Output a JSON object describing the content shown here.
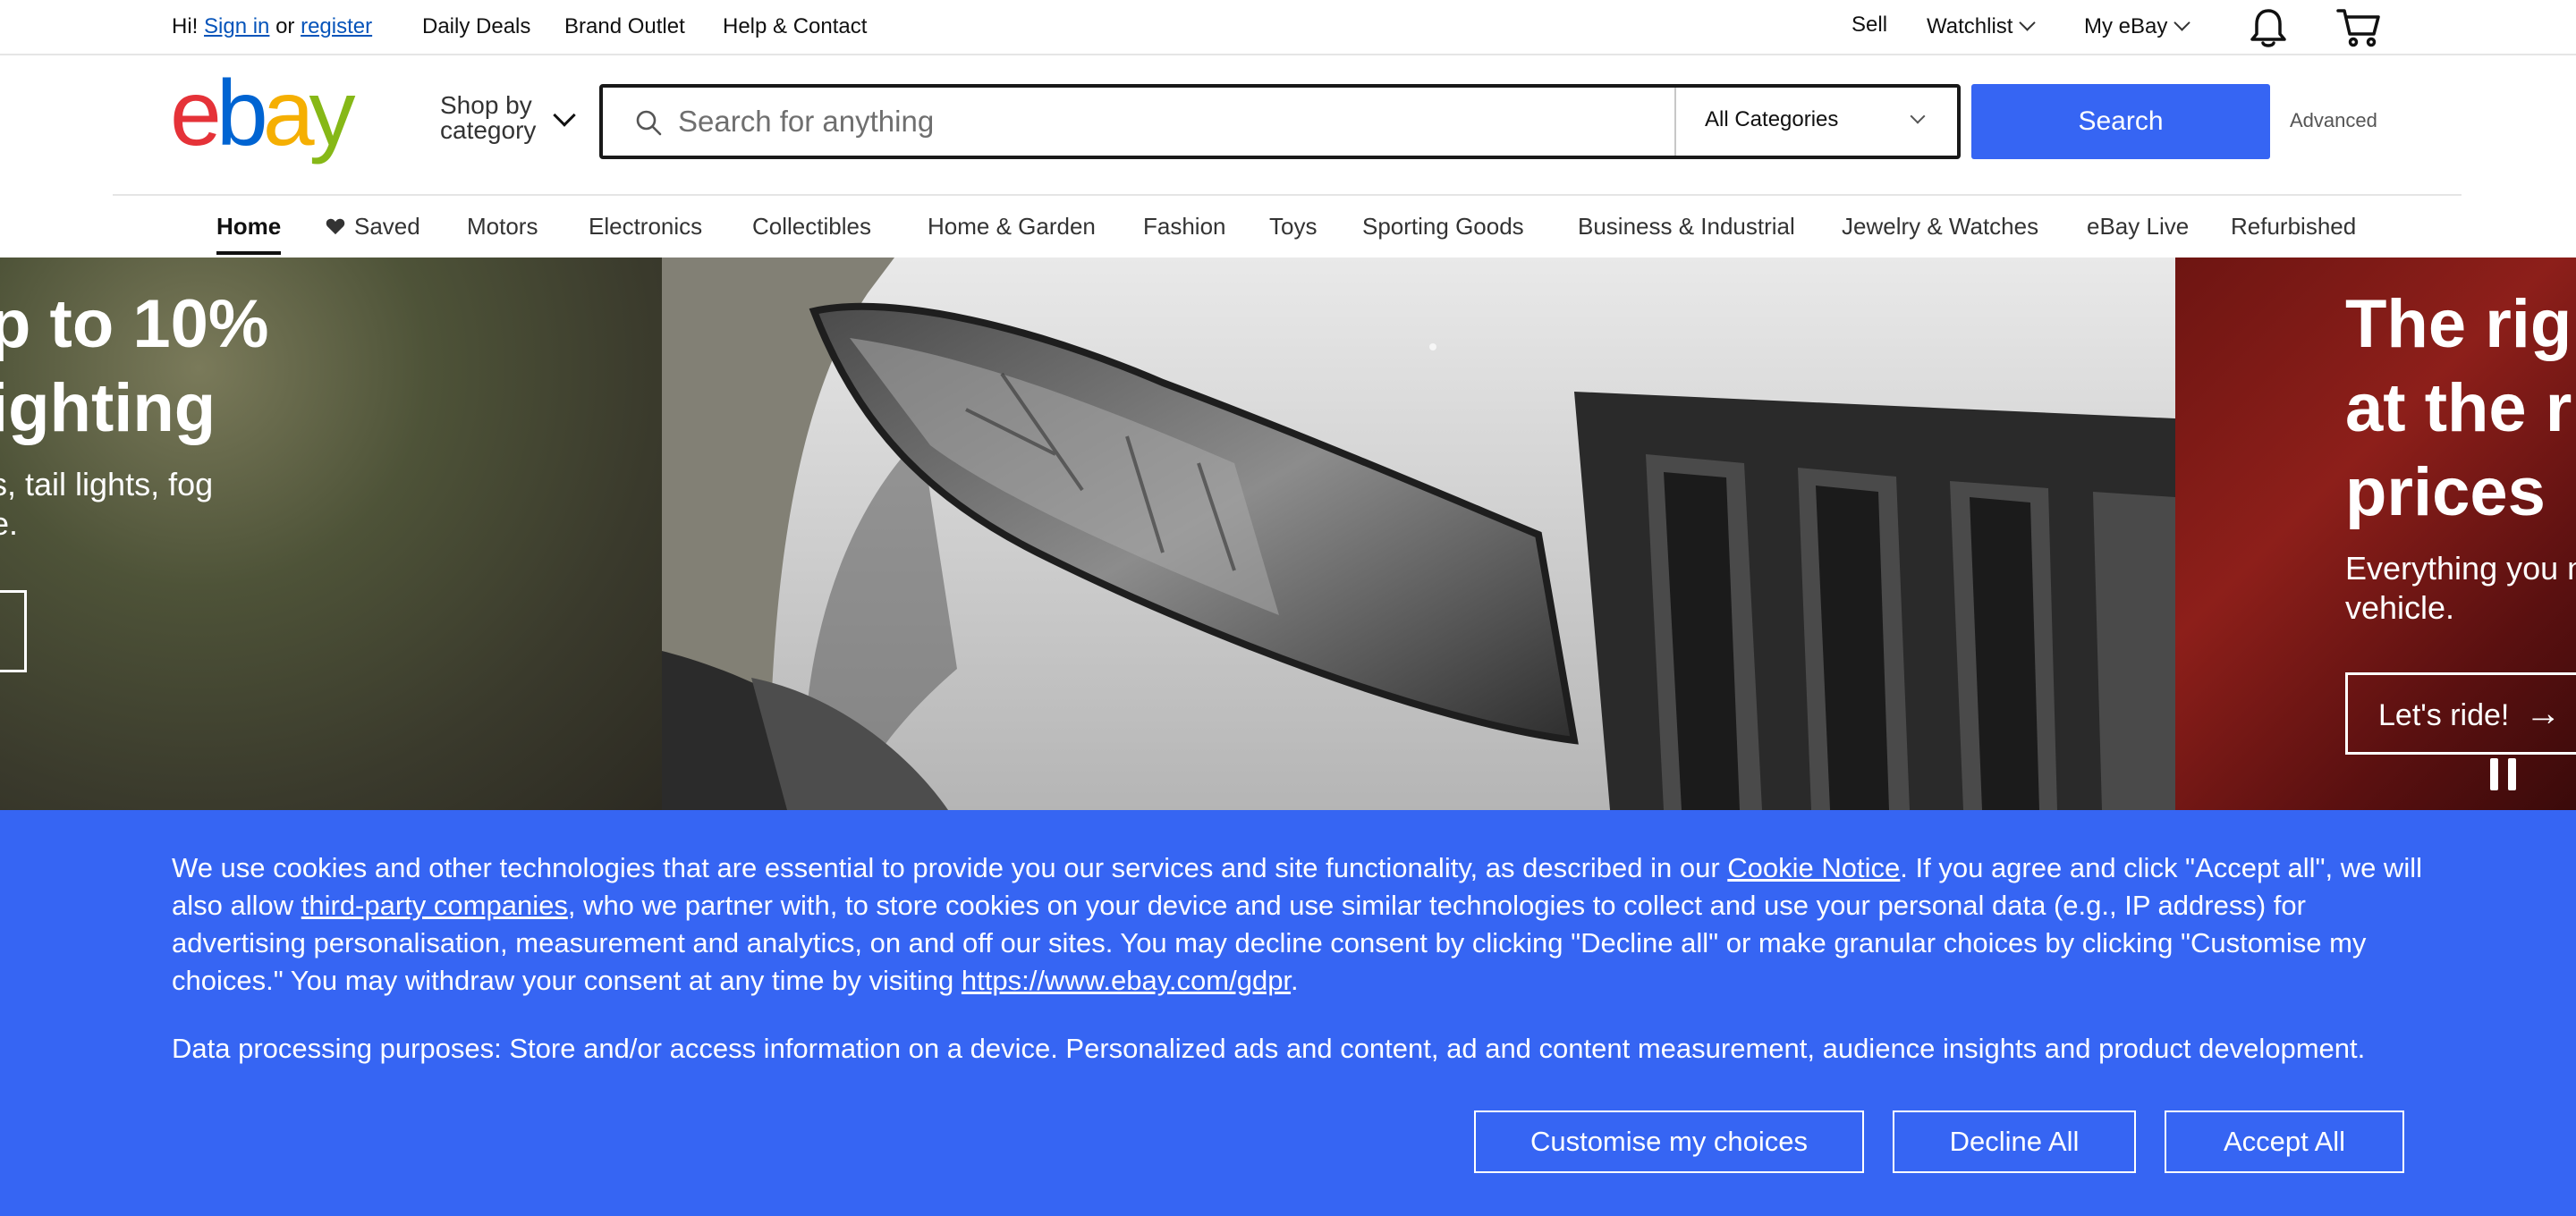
{
  "topbar": {
    "greeting_prefix": "Hi!",
    "sign_in": "Sign in",
    "or": "or",
    "register": "register",
    "daily_deals": "Daily Deals",
    "brand_outlet": "Brand Outlet",
    "help_contact": "Help & Contact",
    "sell": "Sell",
    "watchlist": "Watchlist",
    "my_ebay": "My eBay",
    "icons": [
      "bell-icon",
      "cart-icon"
    ]
  },
  "header": {
    "logo_letters": [
      "e",
      "b",
      "a",
      "y"
    ],
    "logo_colors": [
      "#e53238",
      "#0064d2",
      "#f5af02",
      "#86b817"
    ],
    "shop_by_line1": "Shop by",
    "shop_by_line2": "category",
    "search_placeholder": "Search for anything",
    "category_selected": "All Categories",
    "search_button": "Search",
    "advanced": "Advanced",
    "accent": "#3665f3"
  },
  "nav": {
    "tabs": [
      "Home",
      "Saved",
      "Motors",
      "Electronics",
      "Collectibles",
      "Home & Garden",
      "Fashion",
      "Toys",
      "Sporting Goods",
      "Business & Industrial",
      "Jewelry & Watches",
      "eBay Live",
      "Refurbished"
    ],
    "active": "Home"
  },
  "hero": {
    "left_headline_1": "p to 10%",
    "left_headline_2": "ighting",
    "left_sub_1": "s, tail lights, fog",
    "left_sub_2": "e.",
    "right_headline_1": "The righ",
    "right_headline_2": "at the ri",
    "right_headline_3": "prices",
    "right_sub_1": "Everything you n",
    "right_sub_2": "vehicle.",
    "right_cta": "Let's ride!"
  },
  "cookie": {
    "p1_a": "We use cookies and other technologies that are essential to provide you our services and site functionality, as described in our ",
    "cookie_notice": "Cookie Notice",
    "p1_b": ". If you agree and click \"Accept all\", we will also allow ",
    "third_party": "third-party companies",
    "p1_c": ", who we partner with, to store cookies on your device and use similar technologies to collect and use your personal data (e.g., IP address) for advertising personalisation, measurement and analytics, on and off our sites. You may decline consent by clicking \"Decline all\" or make granular choices by clicking \"Customise my choices.\" You may withdraw your consent at any time by visiting ",
    "gdpr_link": "https://www.ebay.com/gdpr",
    "p1_d": ".",
    "purposes": "Data processing purposes: Store and/or access information on a device. Personalized ads and content, ad and content measurement, audience insights and product development.",
    "customise": "Customise my choices",
    "decline": "Decline All",
    "accept": "Accept All",
    "bg_color": "#3665f3"
  }
}
